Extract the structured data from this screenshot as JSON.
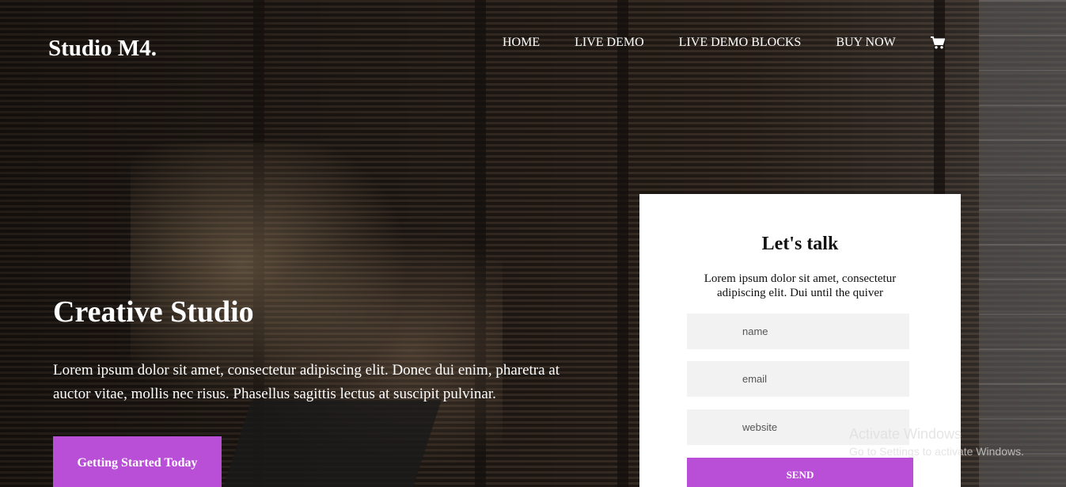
{
  "brand": "Studio M4.",
  "nav": {
    "items": [
      "HOME",
      "LIVE DEMO",
      "LIVE DEMO BLOCKS",
      "BUY NOW"
    ],
    "cart_icon": "cart-icon"
  },
  "hero": {
    "title": "Creative Studio",
    "text": "Lorem ipsum dolor sit amet, consectetur adipiscing elit. Donec dui enim, pharetra at auctor vitae, mollis nec risus. Phasellus sagittis lectus at suscipit pulvinar.",
    "cta_label": "Getting Started Today"
  },
  "contact": {
    "title": "Let's talk",
    "text": "Lorem ipsum dolor sit amet, consectetur adipiscing elit. Dui until the quiver",
    "name_placeholder": "name",
    "email_placeholder": "email",
    "website_placeholder": "website",
    "send_label": "SEND"
  },
  "watermark": {
    "title": "Activate Windows",
    "subtitle": "Go to Settings to activate Windows."
  },
  "colors": {
    "accent": "#b84fd6",
    "card_bg": "#ffffff",
    "field_bg": "#f2f2f2"
  }
}
